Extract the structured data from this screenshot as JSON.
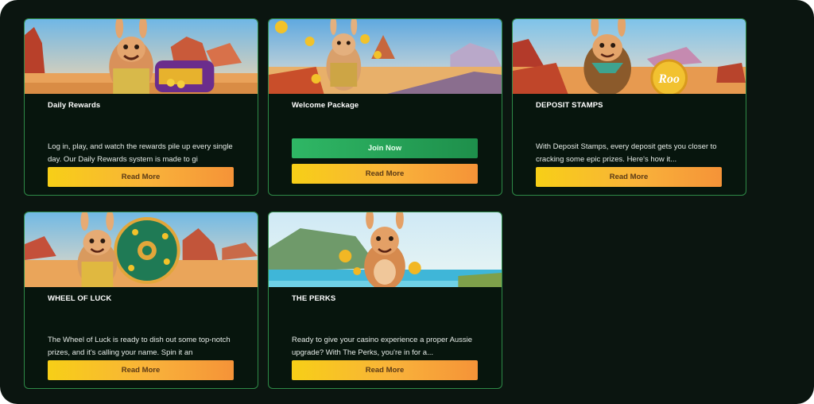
{
  "cards": [
    {
      "title": "Daily Rewards",
      "description": "Log in, play, and watch the rewards pile up every single day. Our Daily Rewards system is made to gi",
      "read_more": "Read More",
      "image": "kangaroo-treasure-chest-desert"
    },
    {
      "title": "Welcome Package",
      "join_now": "Join Now",
      "read_more": "Read More",
      "image": "kangaroo-coins-road"
    },
    {
      "title": "DEPOSIT STAMPS",
      "description": "With Deposit Stamps, every deposit gets you closer to cracking some epic prizes. Here's how it...",
      "read_more": "Read More",
      "image": "kangaroo-roo-coin",
      "coin_text": "Roo"
    },
    {
      "title": "WHEEL OF LUCK",
      "description": "The Wheel of Luck is ready to dish out some top-notch prizes, and it's calling your name. Spin it an",
      "read_more": "Read More",
      "image": "kangaroo-wheel"
    },
    {
      "title": "THE PERKS",
      "description": "Ready to give your casino experience a proper Aussie upgrade? With The Perks, you're in for a...",
      "read_more": "Read More",
      "image": "kangaroo-beach-coins"
    }
  ],
  "colors": {
    "background": "#0b1510",
    "card": "#07150d",
    "card_border": "#2e8a47",
    "button_gold": "#f7cf17",
    "button_green": "#2fb765"
  }
}
